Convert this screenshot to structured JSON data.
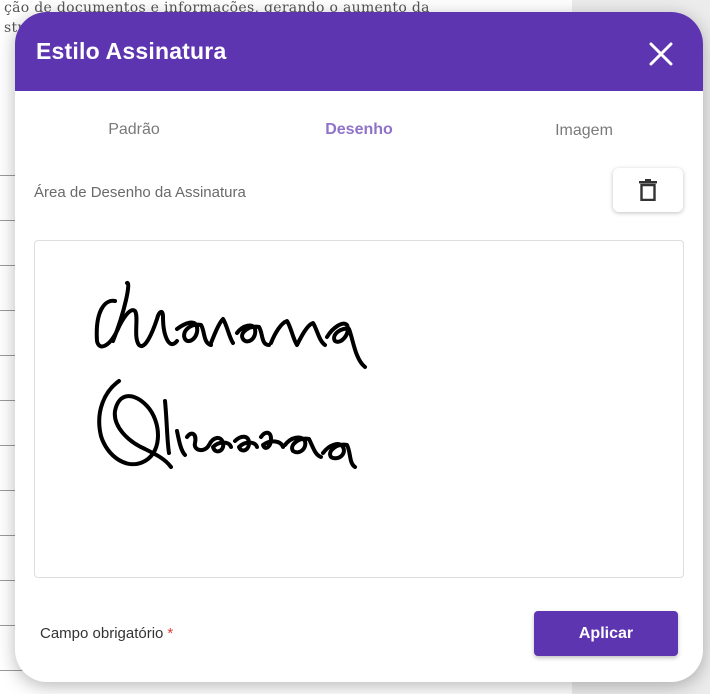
{
  "background_document": {
    "text_line_1": "ção de documentos e informações, gerando o aumento da",
    "text_line_2": "str"
  },
  "dialog": {
    "title": "Estilo Assinatura",
    "close_icon": "close-icon",
    "header_color": "#5e35b1"
  },
  "tabs": [
    {
      "label": "Padrão",
      "active": false
    },
    {
      "label": "Desenho",
      "active": true
    },
    {
      "label": "Imagem",
      "active": false
    }
  ],
  "drawing": {
    "label": "Área de Desenho da Assinatura",
    "clear_icon": "trash-icon",
    "signature_text": "Mariana Oliveira"
  },
  "footer": {
    "required_label": "Campo obrigatório",
    "required_mark": "*",
    "apply_label": "Aplicar"
  },
  "colors": {
    "accent": "#5e35b1",
    "active_tab": "#8f73c8",
    "required": "#e53935"
  }
}
